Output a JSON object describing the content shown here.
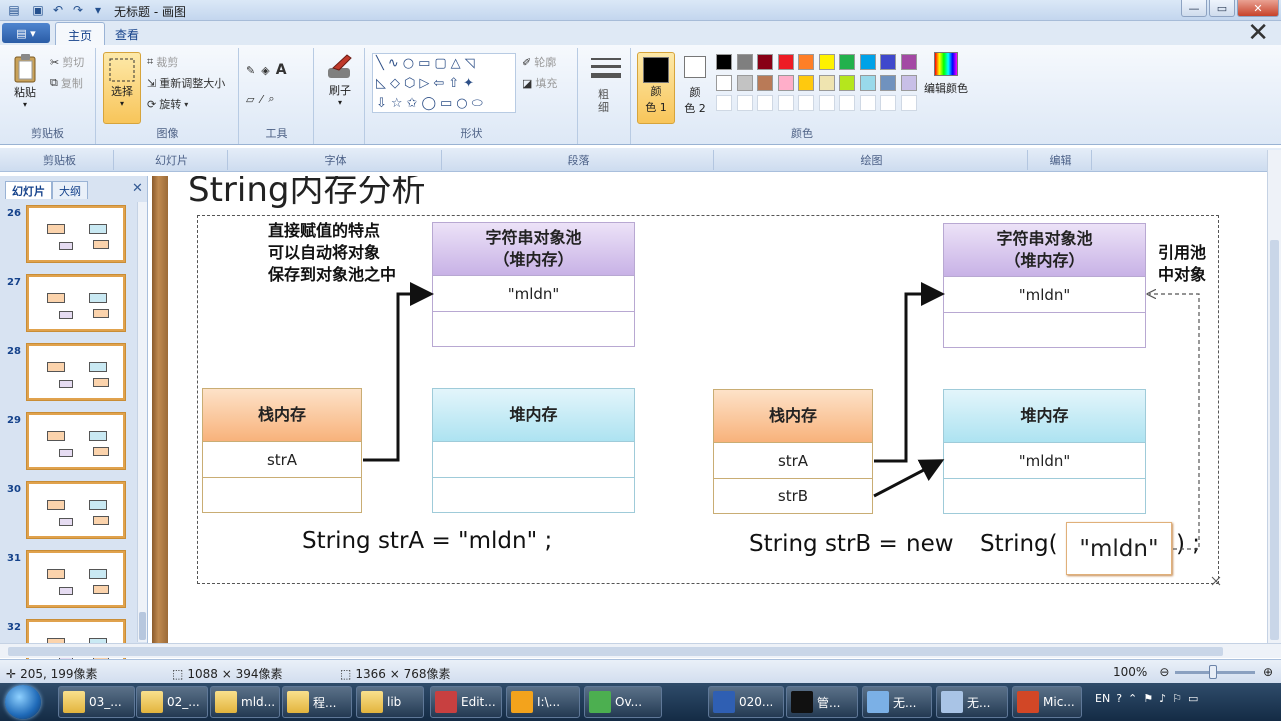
{
  "window": {
    "title": "无标题 - 画图"
  },
  "ribbon_tabs": [
    "主页",
    "查看"
  ],
  "clipboard": {
    "paste": "粘贴",
    "cut": "剪切",
    "copy": "复制",
    "label": "剪贴板"
  },
  "image": {
    "select": "选择",
    "crop": "裁剪",
    "resize": "重新调整大小",
    "rotate": "旋转",
    "label": "图像"
  },
  "tools": {
    "label": "工具"
  },
  "brushes": {
    "label": "刷子"
  },
  "shapes": {
    "outline": "轮廓",
    "fill": "填充",
    "label": "形状"
  },
  "size": {
    "label": "粗细"
  },
  "colors": {
    "color1_label_a": "颜",
    "color1_label_b": "色 1",
    "color2_label_a": "颜",
    "color2_label_b": "色 2",
    "edit": "编辑颜色",
    "label": "颜色",
    "palette_row1": [
      "#000000",
      "#7f7f7f",
      "#880015",
      "#ed1c24",
      "#ff7f27",
      "#fff200",
      "#22b14c",
      "#00a2e8",
      "#3f48cc",
      "#a349a4"
    ],
    "palette_row2": [
      "#ffffff",
      "#c3c3c3",
      "#b97a57",
      "#ffaec9",
      "#ffc90e",
      "#efe4b0",
      "#b5e61d",
      "#99d9ea",
      "#7092be",
      "#c8bfe7"
    ]
  },
  "ppt_groups": [
    "剪贴板",
    "幻灯片",
    "字体",
    "段落",
    "绘图",
    "编辑"
  ],
  "slide_panel": {
    "tabs": [
      "幻灯片",
      "大纲"
    ],
    "slides": [
      26,
      27,
      28,
      29,
      30,
      31,
      32
    ]
  },
  "slide": {
    "title": "String内存分析",
    "left_note": [
      "直接赋值的特点",
      "可以自动将对象",
      "保存到对象池之中"
    ],
    "right_note": [
      "引用池",
      "中对象"
    ],
    "pool_title": "字符串对象池",
    "pool_sub": "（堆内存）",
    "stack_title": "栈内存",
    "heap_title": "堆内存",
    "left": {
      "pool_value": "\"mldn\"",
      "stack_var": "strA",
      "code": "String strA = \"mldn\" ;"
    },
    "right": {
      "pool_value": "\"mldn\"",
      "stack_var1": "strA",
      "stack_var2": "strB",
      "heap_value": "\"mldn\"",
      "code_a": "String strB =",
      "code_b": "new",
      "code_c": "String(",
      "code_box": "\"mldn\"",
      "code_d": ") ;"
    }
  },
  "status": {
    "cursor": "205, 199像素",
    "selection": "1088 × 394像素",
    "canvas_size": "1366 × 768像素",
    "zoom": "100%"
  },
  "taskbar": {
    "items": [
      "03_...",
      "02_...",
      "mld...",
      "程...",
      "lib",
      "Edit...",
      "I:\\...",
      "Ov...",
      "020...",
      "管...",
      "无...",
      "无...",
      "Mic..."
    ],
    "lang": "EN"
  }
}
